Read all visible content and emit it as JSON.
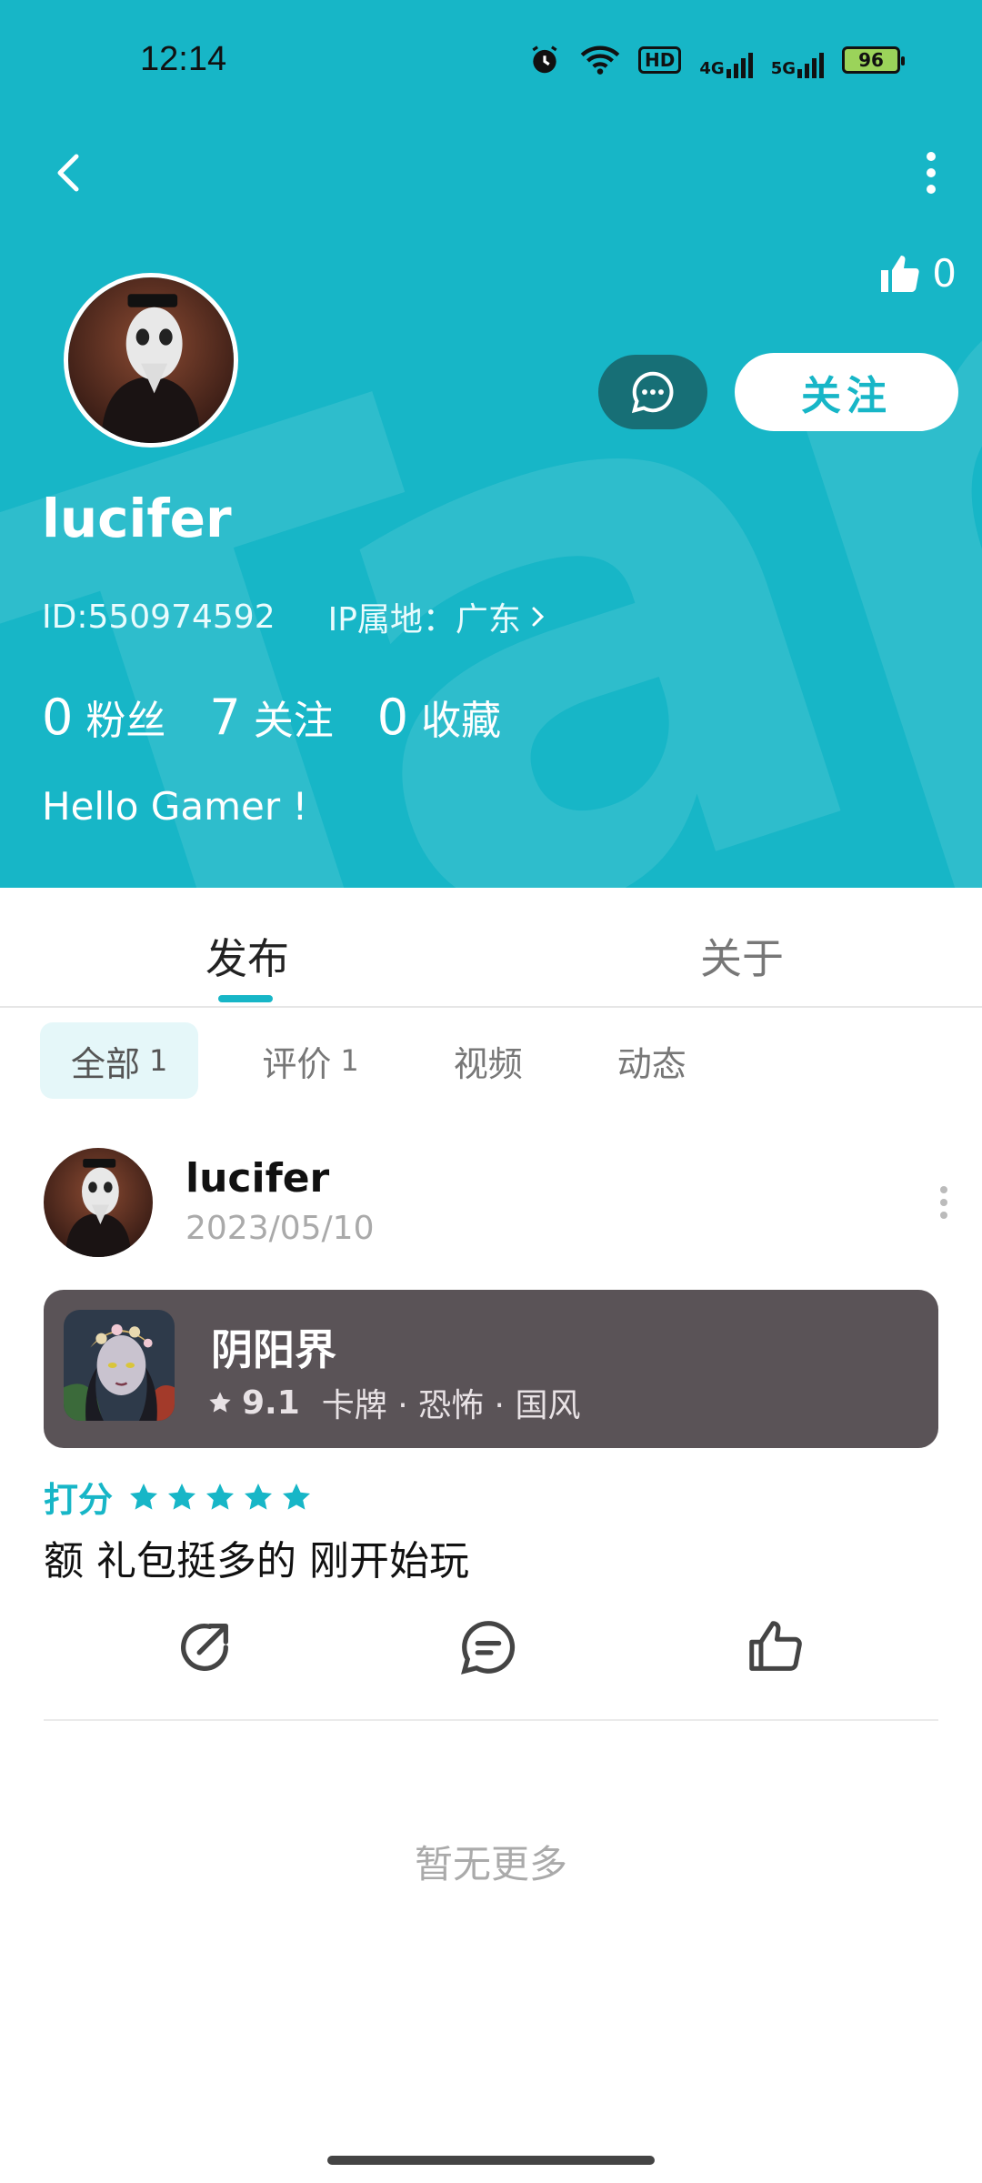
{
  "status_bar": {
    "time": "12:14",
    "hd": "HD",
    "net1": "4G",
    "net2": "5G",
    "battery": "96"
  },
  "profile": {
    "likes": "0",
    "follow_label": "关注",
    "username": "lucifer",
    "id": "ID:550974592",
    "ip": "IP属地：广东",
    "stats": [
      {
        "value": "0",
        "label": "粉丝"
      },
      {
        "value": "7",
        "label": "关注"
      },
      {
        "value": "0",
        "label": "收藏"
      }
    ],
    "bio": "Hello Gamer !"
  },
  "tabs": {
    "publish": "发布",
    "about": "关于"
  },
  "filters": [
    {
      "label": "全部",
      "count": "1"
    },
    {
      "label": "评价",
      "count": "1"
    },
    {
      "label": "视频",
      "count": ""
    },
    {
      "label": "动态",
      "count": ""
    }
  ],
  "post": {
    "username": "lucifer",
    "date": "2023/05/10",
    "game": {
      "title": "阴阳界",
      "score": "9.1",
      "tags": "卡牌 · 恐怖 · 国风"
    },
    "rating_label": "打分",
    "rating_stars": 5,
    "text": "额 礼包挺多的 刚开始玩"
  },
  "footer": {
    "no_more": "暂无更多"
  },
  "colors": {
    "accent": "#17b6c7",
    "card": "#5a5357",
    "dark_teal": "#176f76"
  }
}
